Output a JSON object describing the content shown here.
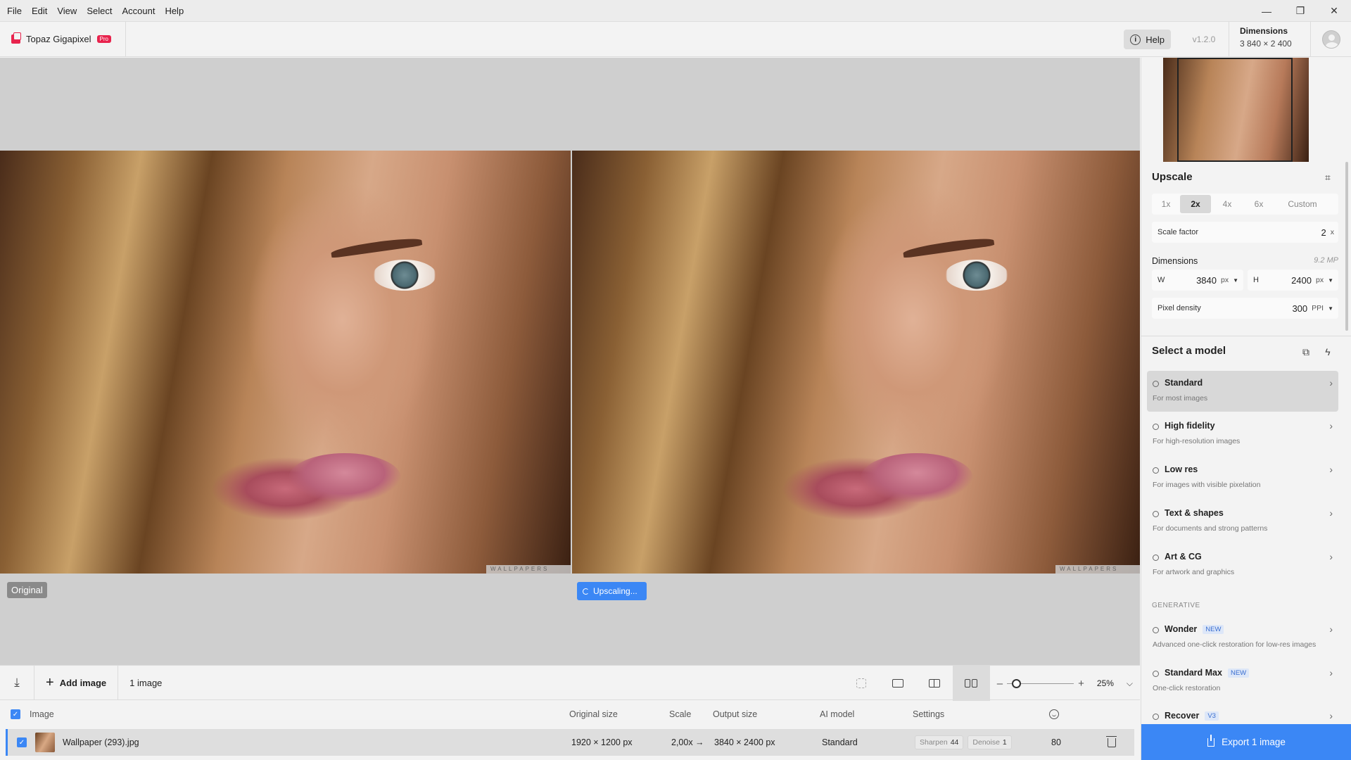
{
  "menu": [
    "File",
    "Edit",
    "View",
    "Select",
    "Account",
    "Help"
  ],
  "window_controls": {
    "minimize": "—",
    "restore": "❐",
    "close": "✕"
  },
  "brand": {
    "name": "Topaz Gigapixel",
    "badge": "Pro"
  },
  "topbar": {
    "help_label": "Help",
    "version": "v1.2.0",
    "dims_title": "Dimensions",
    "dims_value": "3 840 × 2 400"
  },
  "canvas": {
    "original_label": "Original",
    "status": "Upscaling...",
    "watermark": "WALLPAPERS"
  },
  "bottombar": {
    "add_image": "Add image",
    "count": "1 image",
    "zoom": "25%"
  },
  "table": {
    "headers": {
      "image": "Image",
      "original_size": "Original size",
      "scale": "Scale",
      "output_size": "Output size",
      "ai_model": "AI model",
      "settings": "Settings"
    },
    "row": {
      "name": "Wallpaper (293).jpg",
      "original_size": "1920 × 1200 px",
      "scale": "2,00x →",
      "output_size": "3840 × 2400 px",
      "ai_model": "Standard",
      "sharpen_label": "Sharpen",
      "sharpen_value": "44",
      "denoise_label": "Denoise",
      "denoise_value": "1",
      "score": "80"
    }
  },
  "panel": {
    "upscale_title": "Upscale",
    "scale_options": [
      "1x",
      "2x",
      "4x",
      "6x",
      "Custom"
    ],
    "scale_selected": "2x",
    "scale_factor_label": "Scale factor",
    "scale_factor_value": "2",
    "scale_factor_unit": "x",
    "dimensions_label": "Dimensions",
    "megapixels": "9.2 MP",
    "width_label": "W",
    "width_value": "3840",
    "width_unit": "px",
    "height_label": "H",
    "height_value": "2400",
    "height_unit": "px",
    "density_label": "Pixel density",
    "density_value": "300",
    "density_unit": "PPI",
    "model_title": "Select a model",
    "models": [
      {
        "name": "Standard",
        "desc": "For most images",
        "tag": ""
      },
      {
        "name": "High fidelity",
        "desc": "For high-resolution images",
        "tag": ""
      },
      {
        "name": "Low res",
        "desc": "For images with visible pixelation",
        "tag": ""
      },
      {
        "name": "Text & shapes",
        "desc": "For documents and strong patterns",
        "tag": ""
      },
      {
        "name": "Art & CG",
        "desc": "For artwork and graphics",
        "tag": ""
      }
    ],
    "generative_label": "GENERATIVE",
    "gen_models": [
      {
        "name": "Wonder",
        "desc": "Advanced one-click restoration for low-res images",
        "tag": "NEW"
      },
      {
        "name": "Standard Max",
        "desc": "One-click restoration",
        "tag": "NEW"
      },
      {
        "name": "Recover",
        "desc": "",
        "tag": "V3"
      }
    ],
    "export_label": "Export 1 image"
  }
}
